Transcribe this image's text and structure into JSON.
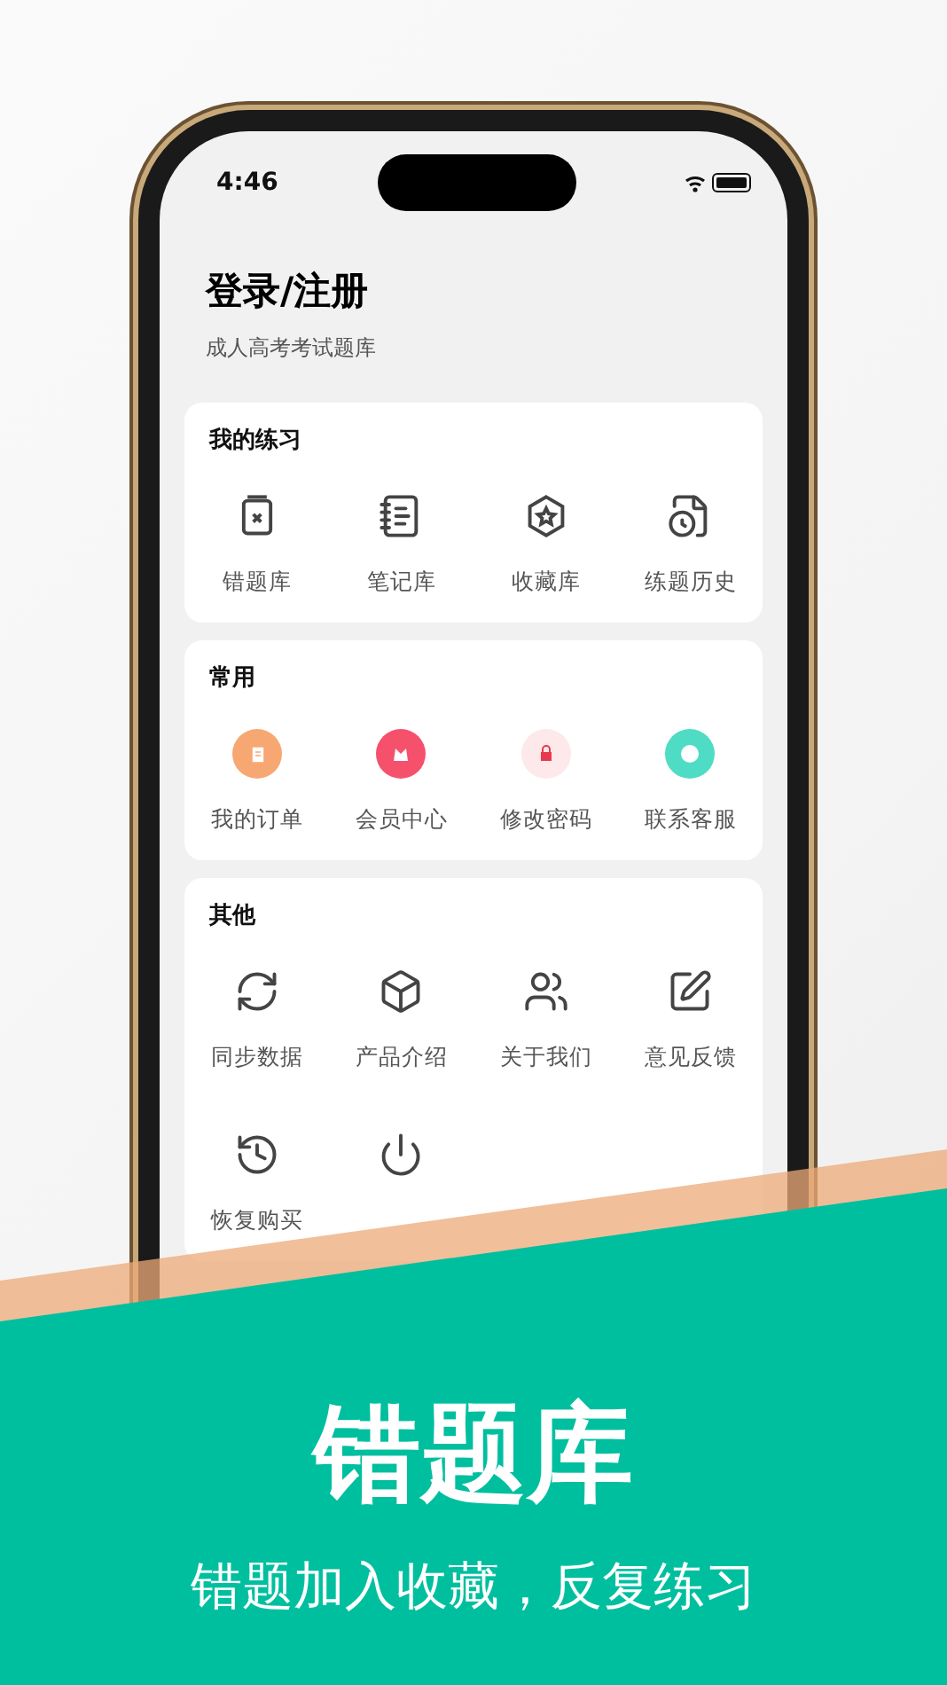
{
  "status_bar": {
    "time": "4:46"
  },
  "header": {
    "title": "登录/注册",
    "subtitle": "成人高考考试题库"
  },
  "sections": [
    {
      "title": "我的练习",
      "kind": "outline",
      "items": [
        {
          "kind": "labeled",
          "label": "错题库"
        },
        {
          "kind": "labeled",
          "label": "笔记库"
        },
        {
          "kind": "labeled",
          "label": "收藏库"
        },
        {
          "kind": "labeled",
          "label": "练题历史"
        }
      ]
    },
    {
      "title": "常用",
      "kind": "colored",
      "items": [
        {
          "kind": "labeled",
          "label": "我的订单",
          "color": "#f7a872"
        },
        {
          "kind": "labeled",
          "label": "会员中心",
          "color": "#f5506c"
        },
        {
          "kind": "labeled",
          "label": "修改密码",
          "color": "#fde8ea"
        },
        {
          "kind": "labeled",
          "label": "联系客服",
          "color": "#4fdcc4"
        }
      ]
    },
    {
      "title": "其他",
      "kind": "outline",
      "items": [
        {
          "kind": "labeled",
          "label": "同步数据"
        },
        {
          "kind": "labeled",
          "label": "产品介绍"
        },
        {
          "kind": "labeled",
          "label": "关于我们"
        },
        {
          "kind": "labeled",
          "label": "意见反馈"
        },
        {
          "kind": "labeled",
          "label": "恢复购买"
        },
        {
          "kind": "icon-only"
        }
      ]
    }
  ],
  "banner": {
    "title": "错题库",
    "subtitle": "错题加入收藏，反复练习"
  }
}
